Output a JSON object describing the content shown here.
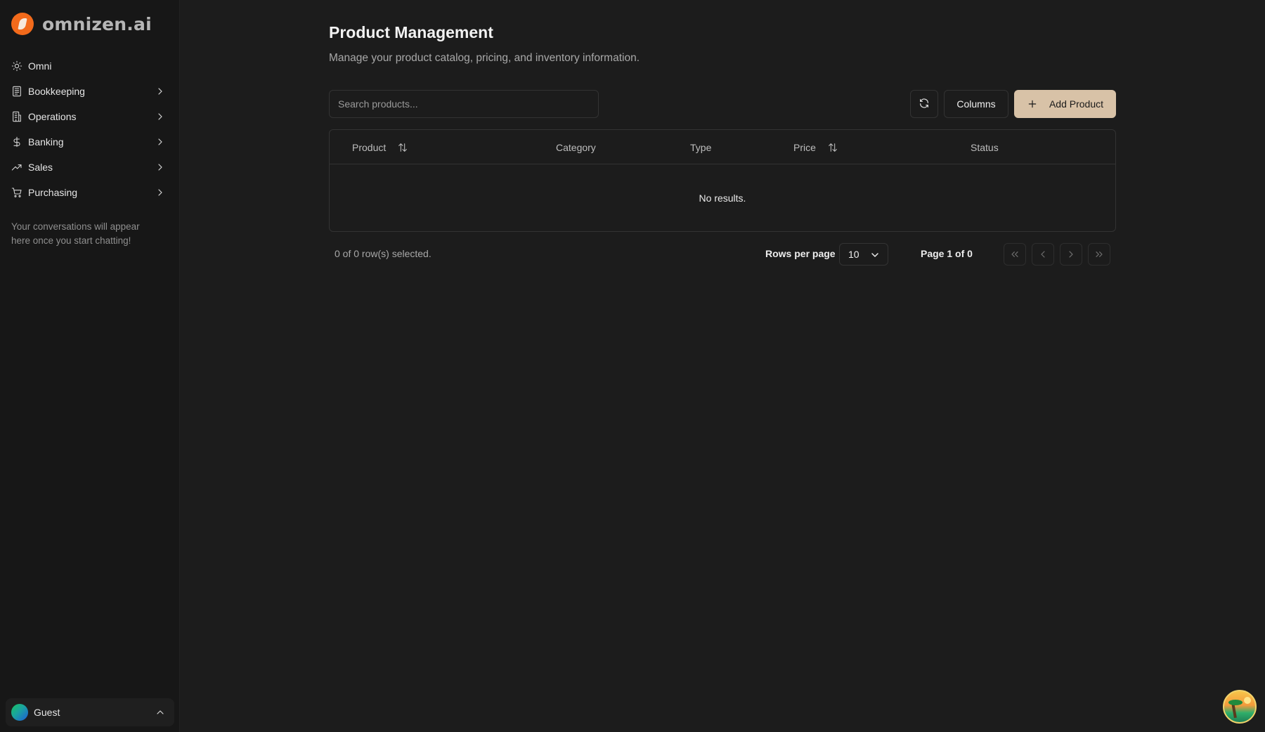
{
  "brand": {
    "name": "omnizen.ai"
  },
  "sidebar": {
    "items": [
      {
        "label": "Omni",
        "icon": "sun-icon",
        "has_submenu": false
      },
      {
        "label": "Bookkeeping",
        "icon": "ledger-icon",
        "has_submenu": true
      },
      {
        "label": "Operations",
        "icon": "building-icon",
        "has_submenu": true
      },
      {
        "label": "Banking",
        "icon": "dollar-icon",
        "has_submenu": true
      },
      {
        "label": "Sales",
        "icon": "trending-up-icon",
        "has_submenu": true
      },
      {
        "label": "Purchasing",
        "icon": "cart-icon",
        "has_submenu": true
      }
    ],
    "empty_note": "Your conversations will appear here once you start chatting!",
    "user": {
      "name": "Guest"
    }
  },
  "page": {
    "title": "Product Management",
    "subtitle": "Manage your product catalog, pricing, and inventory information."
  },
  "toolbar": {
    "search_placeholder": "Search products...",
    "refresh_icon": "refresh-icon",
    "columns_label": "Columns",
    "add_label": "Add Product"
  },
  "table": {
    "columns": [
      "Product",
      "Category",
      "Type",
      "Price",
      "Status"
    ],
    "sortable": [
      "Product",
      "Price"
    ],
    "empty_text": "No results."
  },
  "pagination": {
    "selected_text": "0 of 0 row(s) selected.",
    "rows_per_page_label": "Rows per page",
    "rows_per_page_value": "10",
    "page_text": "Page 1 of 0"
  },
  "colors": {
    "background": "#1c1c1c",
    "sidebar": "#171717",
    "accent": "#d8c2a7",
    "brand": "#f26a1b"
  }
}
